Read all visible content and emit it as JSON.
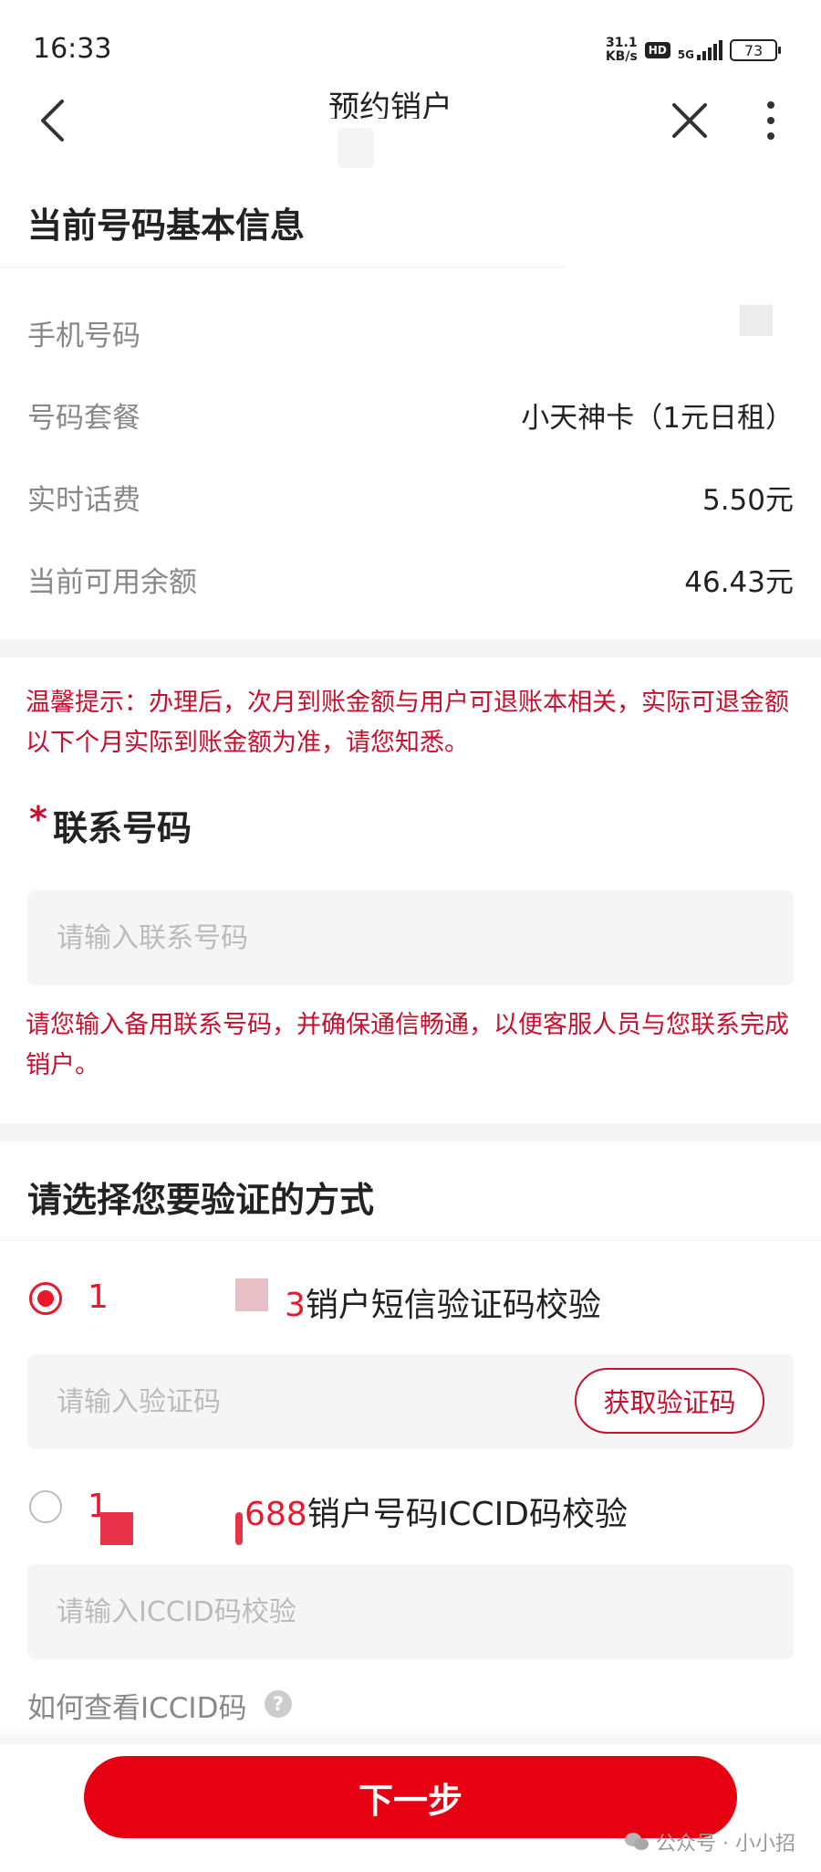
{
  "status_bar": {
    "time": "16:33",
    "net_speed_value": "31.1",
    "net_speed_unit": "KB/s",
    "hd": "HD",
    "network": "5G",
    "battery": "73"
  },
  "nav": {
    "title": "预约销户"
  },
  "basic_info": {
    "title": "当前号码基本信息",
    "rows": [
      {
        "label": "手机号码",
        "value": ""
      },
      {
        "label": "号码套餐",
        "value": "小天神卡（1元日租）"
      },
      {
        "label": "实时话费",
        "value": "5.50元"
      },
      {
        "label": "当前可用余额",
        "value": "46.43元"
      }
    ]
  },
  "tip": "温馨提示：办理后，次月到账金额与用户可退账本相关，实际可退金额以下个月实际到账金额为准，请您知悉。",
  "contact": {
    "required_mark": "*",
    "label": "联系号码",
    "placeholder": "请输入联系号码",
    "hint": "请您输入备用联系号码，并确保通信畅通，以便客服人员与您联系完成销户。"
  },
  "verify": {
    "title": "请选择您要验证的方式",
    "option_sms": {
      "prefix": "1",
      "suffix_digit": "3",
      "text": "销户短信验证码校验",
      "selected": true,
      "placeholder": "请输入验证码",
      "button": "获取验证码"
    },
    "option_iccid": {
      "prefix": "1",
      "suffix_digits": "688",
      "text": "销户号码ICCID码校验",
      "selected": false,
      "placeholder": "请输入ICCID码校验"
    },
    "help": "如何查看ICCID码",
    "help_icon": "?"
  },
  "next_button": "下一步",
  "watermark": "公众号 · 小小招",
  "colors": {
    "primary": "#e60012",
    "alert_text": "#c8102e",
    "label_gray": "#888888",
    "input_bg": "#f5f5f5"
  }
}
